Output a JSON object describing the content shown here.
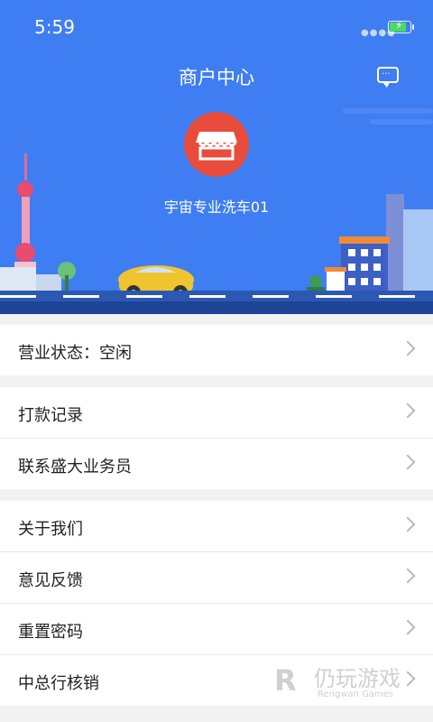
{
  "status_bar": {
    "time": "5:59"
  },
  "header": {
    "title": "商户中心",
    "shop_name": "宇宙专业洗车01"
  },
  "menu_sections": [
    [
      {
        "label": "营业状态：空闲"
      }
    ],
    [
      {
        "label": "打款记录"
      },
      {
        "label": "联系盛大业务员"
      }
    ],
    [
      {
        "label": "关于我们"
      },
      {
        "label": "意见反馈"
      },
      {
        "label": "重置密码"
      },
      {
        "label": "中总行核销"
      }
    ]
  ],
  "watermark": {
    "cn": "仍玩游戏",
    "en": "Rengwan Games"
  },
  "colors": {
    "header_bg": "#3f7df2",
    "logo_bg": "#e84c3d",
    "page_bg": "#f2f2f2"
  }
}
